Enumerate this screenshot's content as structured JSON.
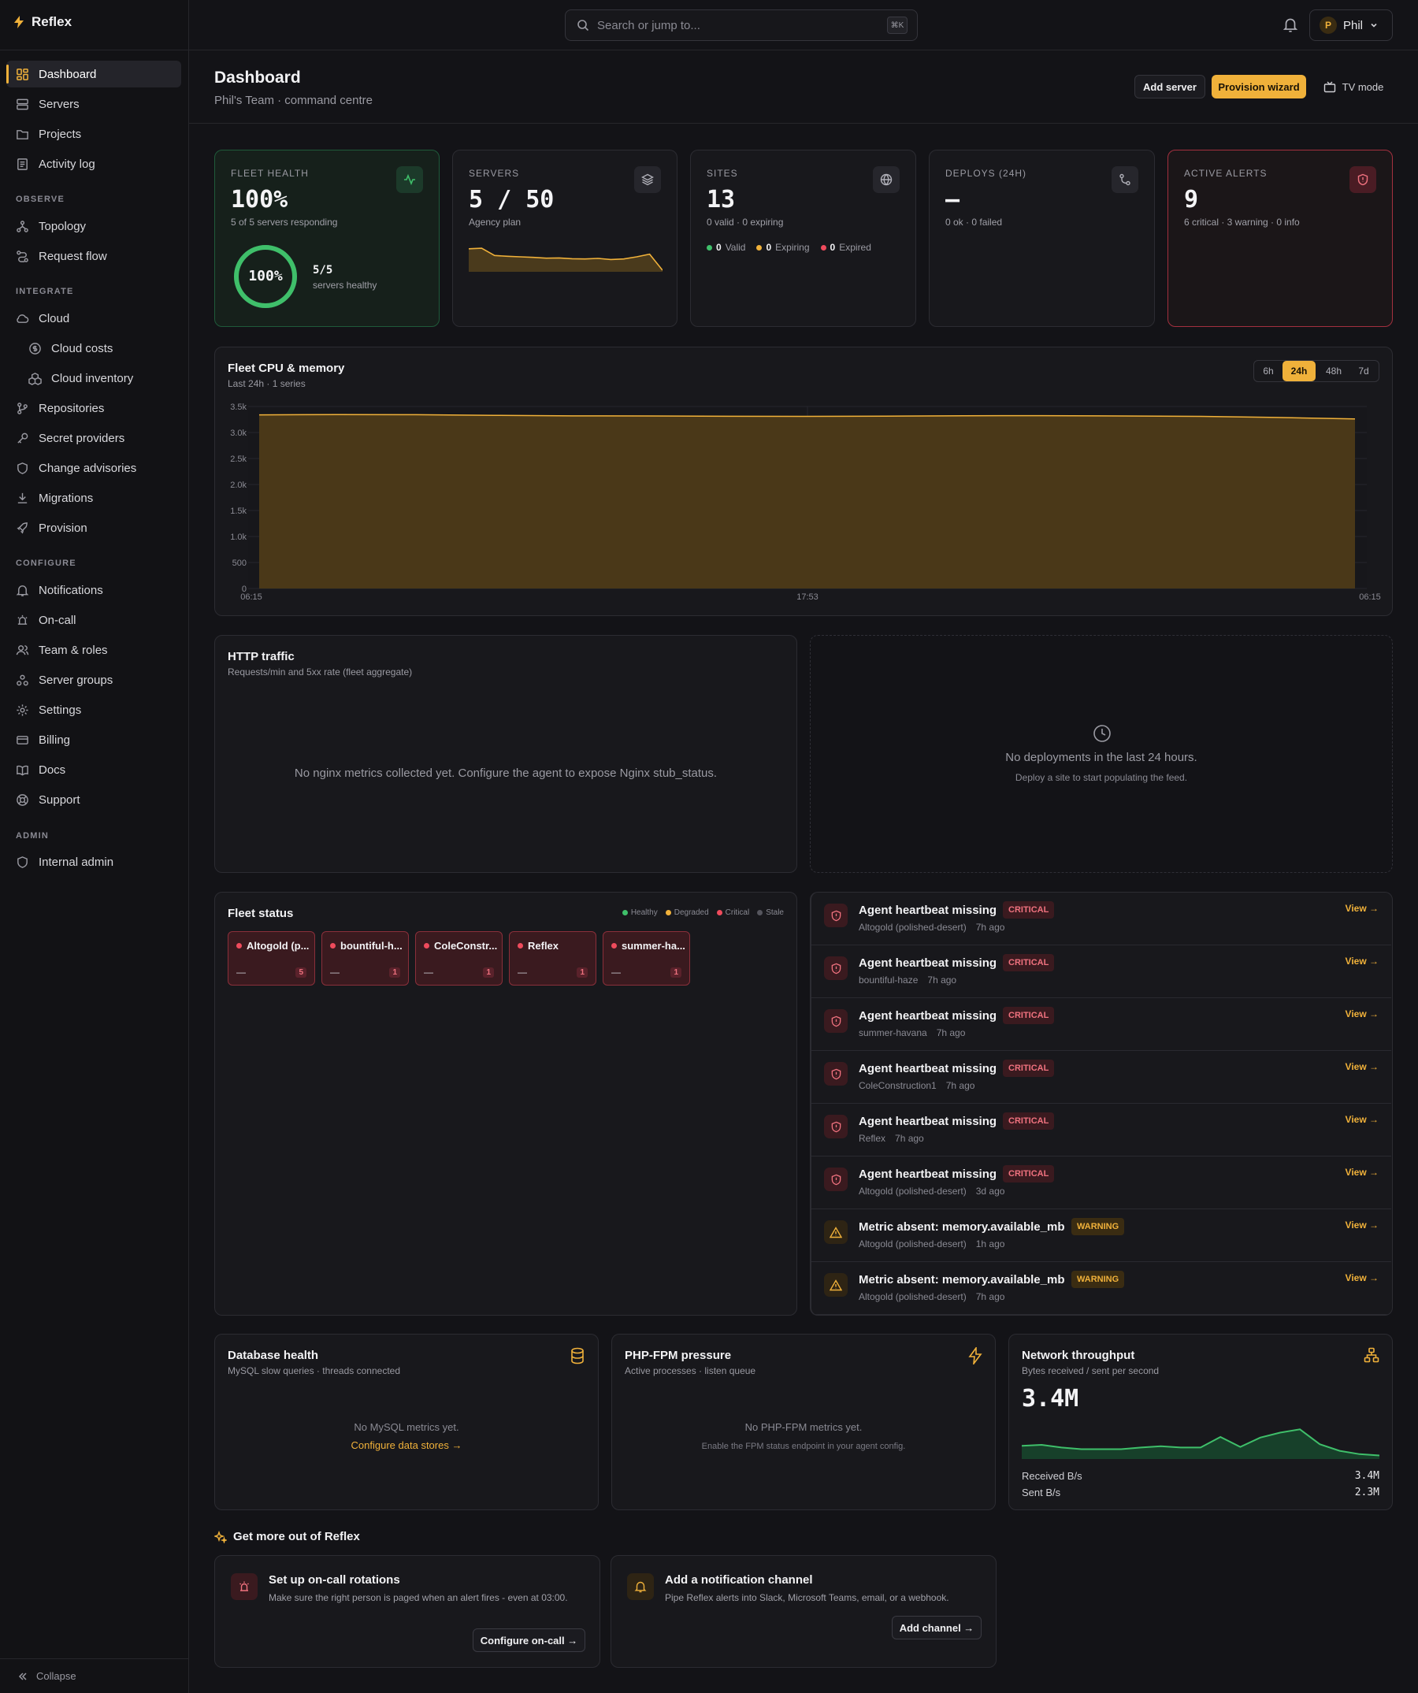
{
  "app": {
    "name": "Reflex"
  },
  "sidebar": {
    "main": [
      {
        "label": "Dashboard"
      },
      {
        "label": "Servers"
      },
      {
        "label": "Projects"
      },
      {
        "label": "Activity log"
      }
    ],
    "observe_heading": "OBSERVE",
    "observe": [
      {
        "label": "Topology"
      },
      {
        "label": "Request flow"
      }
    ],
    "integrate_heading": "INTEGRATE",
    "integrate": [
      {
        "label": "Cloud"
      },
      {
        "label": "Cloud costs"
      },
      {
        "label": "Cloud inventory"
      },
      {
        "label": "Repositories"
      },
      {
        "label": "Secret providers"
      },
      {
        "label": "Change advisories"
      },
      {
        "label": "Migrations"
      },
      {
        "label": "Provision"
      }
    ],
    "configure_heading": "CONFIGURE",
    "configure": [
      {
        "label": "Notifications"
      },
      {
        "label": "On-call"
      },
      {
        "label": "Team & roles"
      },
      {
        "label": "Server groups"
      },
      {
        "label": "Settings"
      },
      {
        "label": "Billing"
      },
      {
        "label": "Docs"
      },
      {
        "label": "Support"
      }
    ],
    "admin_heading": "ADMIN",
    "admin": [
      {
        "label": "Internal admin"
      }
    ],
    "collapse_label": "Collapse"
  },
  "topbar": {
    "search_placeholder": "Search or jump to...",
    "search_shortcut": "⌘K",
    "user_initial": "P",
    "user_name": "Phil"
  },
  "header": {
    "title": "Dashboard",
    "subtitle": "Phil's Team · command centre",
    "add_server": "Add server",
    "provision_wizard": "Provision wizard",
    "tv_mode": "TV mode"
  },
  "kpis": {
    "fleet": {
      "label": "FLEET HEALTH",
      "value": "100%",
      "sub": "5 of 5 servers responding",
      "ring_value": "100%",
      "ring_fraction": 1.0,
      "count": "5/5",
      "count_label": "servers healthy"
    },
    "servers": {
      "label": "SERVERS",
      "value": "5 / 50",
      "sub": "Agency plan",
      "spark": [
        0.8,
        0.82,
        0.55,
        0.52,
        0.5,
        0.48,
        0.45,
        0.46,
        0.43,
        0.42,
        0.44,
        0.4,
        0.42,
        0.5,
        0.6,
        0.0
      ]
    },
    "sites": {
      "label": "SITES",
      "value": "13",
      "sub": "0 valid · 0 expiring",
      "legend": [
        {
          "count": "0",
          "label": "Valid",
          "color": "#3fbf6a"
        },
        {
          "count": "0",
          "label": "Expiring",
          "color": "#f0b13a"
        },
        {
          "count": "0",
          "label": "Expired",
          "color": "#ef4b5c"
        }
      ]
    },
    "deploys": {
      "label": "DEPLOYS (24H)",
      "value": "—",
      "sub": "0 ok · 0 failed"
    },
    "alerts": {
      "label": "ACTIVE ALERTS",
      "value": "9",
      "sub": "6 critical · 3 warning · 0 info"
    }
  },
  "cpu_chart": {
    "title": "Fleet CPU & memory",
    "subtitle": "Last 24h · 1 series",
    "ranges": [
      "6h",
      "24h",
      "48h",
      "7d"
    ],
    "active_range": "24h",
    "color": "#f0b13a"
  },
  "chart_data": {
    "type": "area",
    "x": [
      "06:15",
      "17:53",
      "06:15"
    ],
    "xticks": [
      "06:15",
      "17:53",
      "06:15"
    ],
    "yticks": [
      "0",
      "500",
      "1.0k",
      "1.5k",
      "2.0k",
      "2.5k",
      "3.0k",
      "3.5k"
    ],
    "ylim": [
      0,
      3500
    ],
    "series": [
      {
        "values": [
          3340,
          3345,
          3342,
          3330,
          3320,
          3318,
          3312,
          3310,
          3315,
          3322,
          3325,
          3318,
          3310,
          3290,
          3260
        ]
      }
    ]
  },
  "http": {
    "title": "HTTP traffic",
    "subtitle": "Requests/min and 5xx rate (fleet aggregate)",
    "empty": "No nginx metrics collected yet. Configure the agent to expose Nginx stub_status."
  },
  "deployments": {
    "empty_title": "No deployments in the last 24 hours.",
    "empty_sub": "Deploy a site to start populating the feed."
  },
  "fleet_status": {
    "title": "Fleet status",
    "legend": [
      {
        "label": "Healthy",
        "color": "#3fbf6a"
      },
      {
        "label": "Degraded",
        "color": "#f0b13a"
      },
      {
        "label": "Critical",
        "color": "#ef4b5c"
      },
      {
        "label": "Stale",
        "color": "#55555d"
      }
    ],
    "servers": [
      {
        "name": "Altogold (p...",
        "metric": "—",
        "count": "5"
      },
      {
        "name": "bountiful-h...",
        "metric": "—",
        "count": "1"
      },
      {
        "name": "ColeConstr...",
        "metric": "—",
        "count": "1"
      },
      {
        "name": "Reflex",
        "metric": "—",
        "count": "1"
      },
      {
        "name": "summer-ha...",
        "metric": "—",
        "count": "1"
      }
    ]
  },
  "alerts": {
    "view_label": "View →",
    "items": [
      {
        "title": "Agent heartbeat missing",
        "severity": "CRITICAL",
        "server": "Altogold (polished-desert)",
        "age": "7h ago"
      },
      {
        "title": "Agent heartbeat missing",
        "severity": "CRITICAL",
        "server": "bountiful-haze",
        "age": "7h ago"
      },
      {
        "title": "Agent heartbeat missing",
        "severity": "CRITICAL",
        "server": "summer-havana",
        "age": "7h ago"
      },
      {
        "title": "Agent heartbeat missing",
        "severity": "CRITICAL",
        "server": "ColeConstruction1",
        "age": "7h ago"
      },
      {
        "title": "Agent heartbeat missing",
        "severity": "CRITICAL",
        "server": "Reflex",
        "age": "7h ago"
      },
      {
        "title": "Agent heartbeat missing",
        "severity": "CRITICAL",
        "server": "Altogold (polished-desert)",
        "age": "3d ago"
      },
      {
        "title": "Metric absent: memory.available_mb",
        "severity": "WARNING",
        "server": "Altogold (polished-desert)",
        "age": "1h ago"
      },
      {
        "title": "Metric absent: memory.available_mb",
        "severity": "WARNING",
        "server": "Altogold (polished-desert)",
        "age": "7h ago"
      }
    ]
  },
  "database": {
    "title": "Database health",
    "subtitle": "MySQL slow queries · threads connected",
    "empty": "No MySQL metrics yet.",
    "link": "Configure data stores →"
  },
  "phpfpm": {
    "title": "PHP-FPM pressure",
    "subtitle": "Active processes · listen queue",
    "empty": "No PHP-FPM metrics yet.",
    "hint": "Enable the FPM status endpoint in your agent config."
  },
  "network": {
    "title": "Network throughput",
    "subtitle": "Bytes received / sent per second",
    "value": "3.4M",
    "received_label": "Received B/s",
    "received_value": "3.4M",
    "sent_label": "Sent B/s",
    "sent_value": "2.3M",
    "spark": [
      0.35,
      0.38,
      0.3,
      0.25,
      0.25,
      0.25,
      0.3,
      0.34,
      0.3,
      0.3,
      0.62,
      0.32,
      0.6,
      0.75,
      0.85,
      0.4,
      0.2,
      0.1,
      0.06
    ]
  },
  "promo": {
    "heading": "Get more out of Reflex",
    "oncall": {
      "title": "Set up on-call rotations",
      "body": "Make sure the right person is paged when an alert fires - even at 03:00.",
      "button": "Configure on-call →"
    },
    "notify": {
      "title": "Add a notification channel",
      "body": "Pipe Reflex alerts into Slack, Microsoft Teams, email, or a webhook.",
      "button": "Add channel →"
    }
  }
}
